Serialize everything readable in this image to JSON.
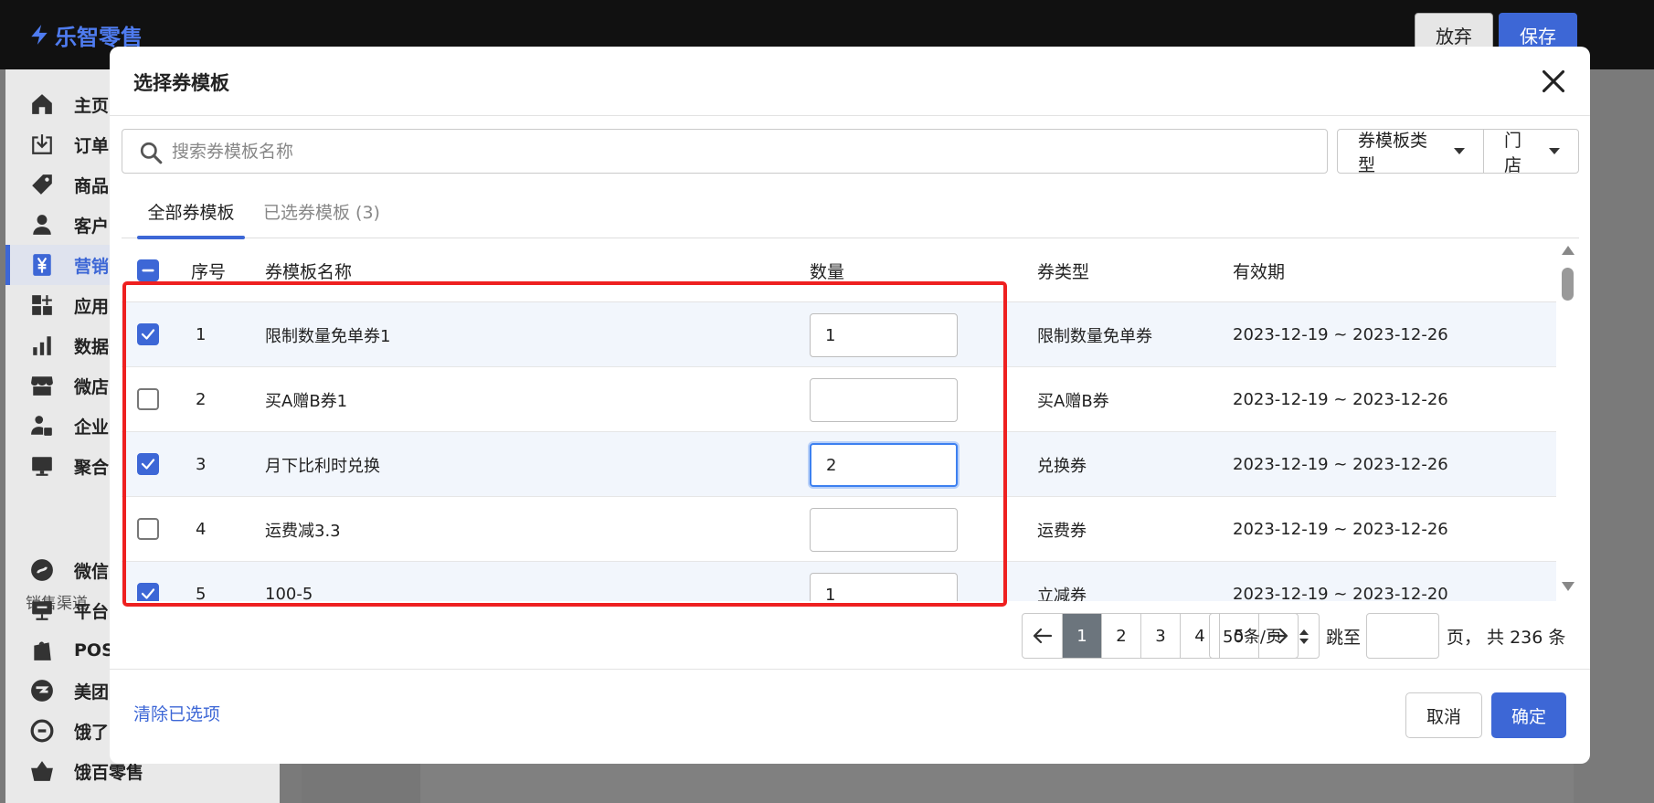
{
  "app": {
    "logo_text": "乐智零售",
    "abandon_label": "放弃",
    "save_label": "保存"
  },
  "sidebar": {
    "items": [
      {
        "label": "主页",
        "icon": "home-icon"
      },
      {
        "label": "订单",
        "icon": "download-icon"
      },
      {
        "label": "商品",
        "icon": "tag-icon"
      },
      {
        "label": "客户",
        "icon": "person-icon"
      },
      {
        "label": "营销",
        "icon": "yen-icon",
        "active": true
      },
      {
        "label": "应用",
        "icon": "apps-icon"
      },
      {
        "label": "数据",
        "icon": "bar-chart-icon"
      },
      {
        "label": "微店",
        "icon": "store-icon"
      },
      {
        "label": "企业",
        "icon": "enterprise-user-icon"
      },
      {
        "label": "聚合",
        "icon": "monitor-icon"
      }
    ],
    "section_title": "销售渠道",
    "channels": [
      {
        "label": "微信",
        "icon": "wechat-icon"
      },
      {
        "label": "平台",
        "icon": "platform-icon"
      },
      {
        "label": "POS",
        "icon": "shopify-bag-icon"
      },
      {
        "label": "美团",
        "icon": "meituan-icon"
      },
      {
        "label": "饿了",
        "icon": "eleme-icon"
      },
      {
        "label": "饿百零售",
        "icon": "basket-icon"
      }
    ]
  },
  "modal": {
    "title": "选择券模板",
    "search_placeholder": "搜索券模板名称",
    "filters": {
      "type_label": "券模板类型",
      "store_label": "门店"
    },
    "tabs": {
      "all": "全部券模板",
      "selected": "已选券模板 (3)"
    },
    "table": {
      "headers": {
        "index": "序号",
        "name": "券模板名称",
        "quantity": "数量",
        "type": "券类型",
        "validity": "有效期"
      },
      "rows": [
        {
          "index": "1",
          "name": "限制数量免单券1",
          "quantity": "1",
          "type": "限制数量免单券",
          "validity": "2023-12-19 ~ 2023-12-26",
          "checked": true
        },
        {
          "index": "2",
          "name": "买A赠B券1",
          "quantity": "",
          "type": "买A赠B券",
          "validity": "2023-12-19 ~ 2023-12-26",
          "checked": false
        },
        {
          "index": "3",
          "name": "月下比利时兑换",
          "quantity": "2",
          "type": "兑换券",
          "validity": "2023-12-19 ~ 2023-12-26",
          "checked": true
        },
        {
          "index": "4",
          "name": "运费减3.3",
          "quantity": "",
          "type": "运费券",
          "validity": "2023-12-19 ~ 2023-12-26",
          "checked": false
        },
        {
          "index": "5",
          "name": "100-5",
          "quantity": "1",
          "type": "立减券",
          "validity": "2023-12-19 ~ 2023-12-20",
          "checked": true
        }
      ]
    },
    "pagination": {
      "pages": [
        "1",
        "2",
        "3",
        "4",
        "5"
      ],
      "current": "1",
      "page_size": "50条/页",
      "jump_to": "跳至",
      "total_text": "页， 共 236 条"
    },
    "footer": {
      "clear_label": "清除已选项",
      "cancel_label": "取消",
      "ok_label": "确定"
    }
  }
}
